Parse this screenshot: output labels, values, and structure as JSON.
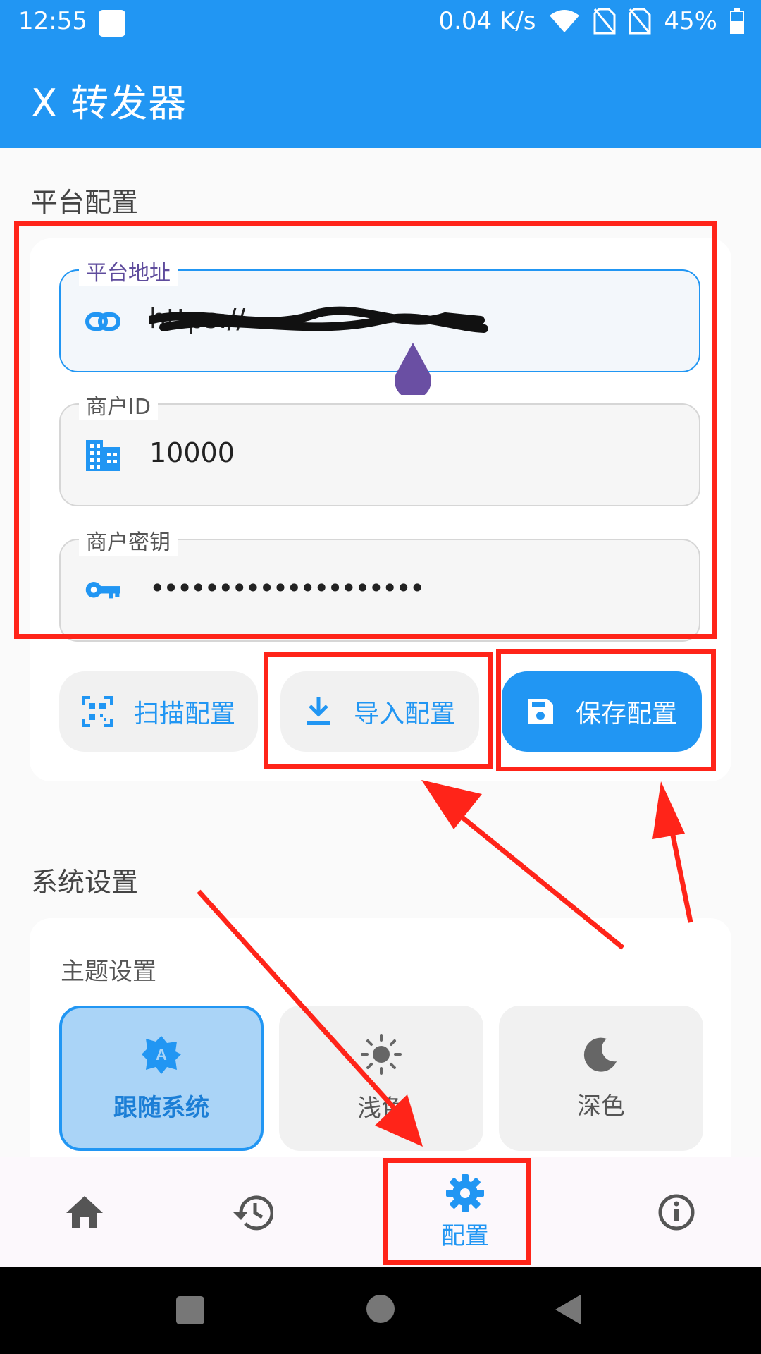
{
  "status_bar": {
    "time": "12:55",
    "network_speed": "0.04 K/s",
    "battery": "45%"
  },
  "app_bar": {
    "title": "X 转发器"
  },
  "platform_section": {
    "title": "平台配置",
    "fields": [
      {
        "label": "平台地址",
        "value": "https://",
        "icon": "link-icon"
      },
      {
        "label": "商户ID",
        "value": "10000",
        "icon": "building-icon"
      },
      {
        "label": "商户密钥",
        "value": "••••••••••••••••••••",
        "icon": "key-icon"
      }
    ],
    "buttons": {
      "scan": "扫描配置",
      "import": "导入配置",
      "save": "保存配置"
    }
  },
  "system_section": {
    "title": "系统设置",
    "theme_title": "主题设置",
    "themes": [
      {
        "label": "跟随系统",
        "icon": "auto-theme-icon",
        "selected": true
      },
      {
        "label": "浅色",
        "icon": "sun-icon",
        "selected": false
      },
      {
        "label": "深色",
        "icon": "moon-icon",
        "selected": false
      }
    ]
  },
  "bottom_nav": {
    "items": [
      {
        "icon": "home-icon",
        "label": ""
      },
      {
        "icon": "history-icon",
        "label": ""
      },
      {
        "icon": "gear-icon",
        "label": "配置",
        "active": true
      },
      {
        "icon": "info-icon",
        "label": ""
      }
    ]
  },
  "colors": {
    "primary": "#2196f3",
    "annotation_red": "#ff2419",
    "selected_theme_bg": "#aad4f7",
    "cursor_handle": "#6a4fa3"
  }
}
